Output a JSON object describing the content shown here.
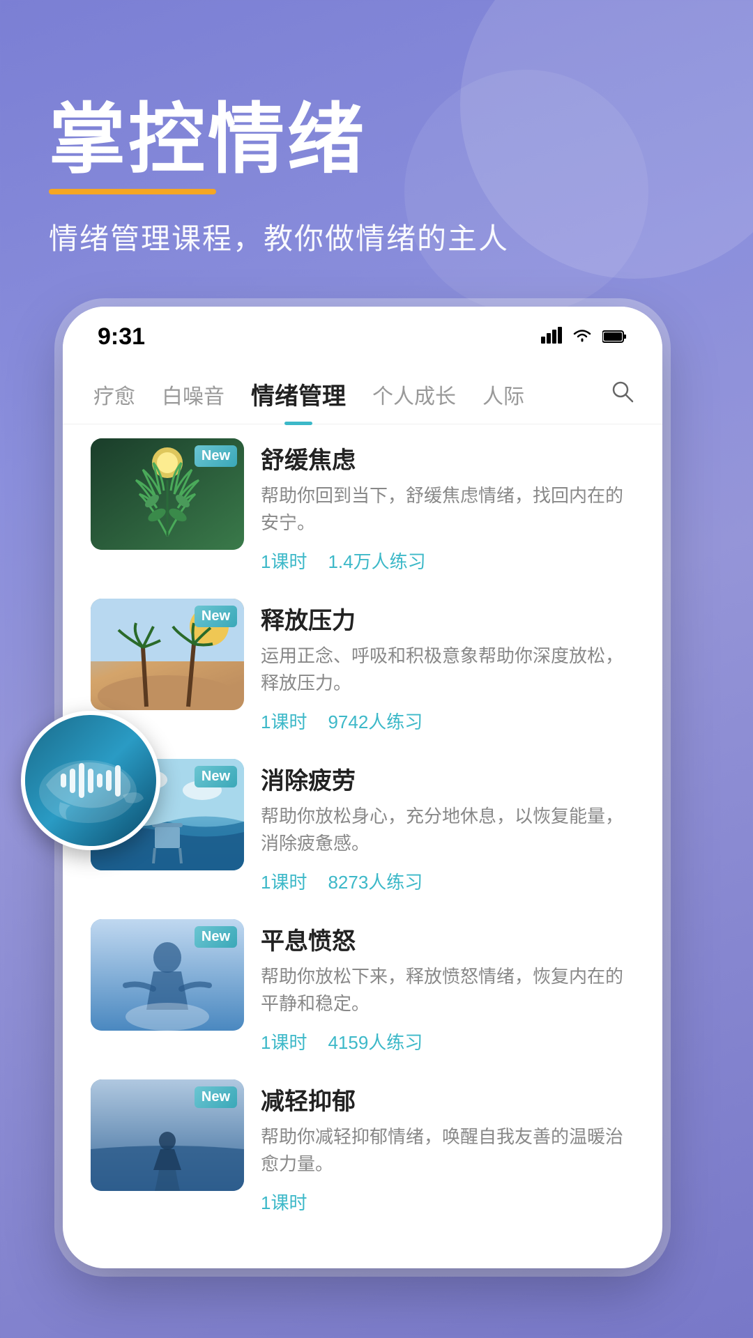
{
  "background": {
    "gradient_start": "#7b7fd4",
    "gradient_end": "#7878c8"
  },
  "header": {
    "title_bold": "掌控",
    "title_normal": "情绪",
    "underline_color": "#f5a623",
    "subtitle": "情绪管理课程，教你做情绪的主人"
  },
  "status_bar": {
    "time": "9:31"
  },
  "nav": {
    "tabs": [
      {
        "label": "疗愈",
        "active": false
      },
      {
        "label": "白噪音",
        "active": false
      },
      {
        "label": "情绪管理",
        "active": true
      },
      {
        "label": "个人成长",
        "active": false
      },
      {
        "label": "人际",
        "active": false
      }
    ]
  },
  "courses": [
    {
      "title": "舒缓焦虑",
      "desc": "帮助你回到当下，舒缓焦虑情绪，找回内在的安宁。",
      "lessons": "1课时",
      "students": "1.4万人练习",
      "is_new": true,
      "thumb_type": "1"
    },
    {
      "title": "释放压力",
      "desc": "运用正念、呼吸和积极意象帮助你深度放松，释放压力。",
      "lessons": "1课时",
      "students": "9742人练习",
      "is_new": true,
      "thumb_type": "2"
    },
    {
      "title": "消除疲劳",
      "desc": "帮助你放松身心，充分地休息，以恢复能量，消除疲惫感。",
      "lessons": "1课时",
      "students": "8273人练习",
      "is_new": true,
      "thumb_type": "3"
    },
    {
      "title": "平息愤怒",
      "desc": "帮助你放松下来，释放愤怒情绪，恢复内在的平静和稳定。",
      "lessons": "1课时",
      "students": "4159人练习",
      "is_new": true,
      "thumb_type": "4"
    },
    {
      "title": "减轻抑郁",
      "desc": "帮助你减轻抑郁情绪，唤醒自我友善的温暖治愈力量。",
      "lessons": "1课时",
      "students": "",
      "is_new": true,
      "thumb_type": "5"
    }
  ],
  "new_badge_label": "New",
  "audio_player": {
    "visible": true
  }
}
